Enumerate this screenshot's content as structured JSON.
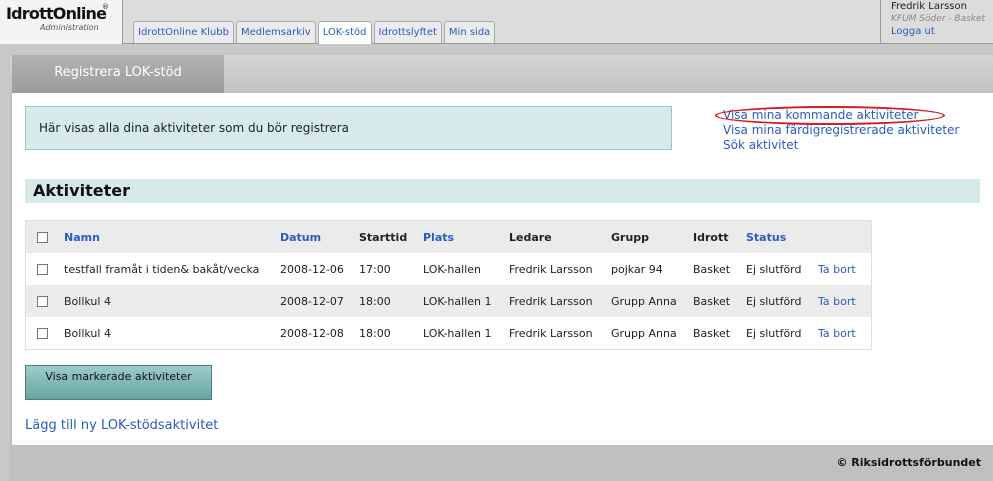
{
  "header": {
    "logo_text": "IdrottOnline",
    "logo_reg": "®",
    "logo_sub": "Administration",
    "tabs": [
      {
        "label": "IdrottOnline Klubb"
      },
      {
        "label": "Medlemsarkiv"
      },
      {
        "label": "LOK-stöd"
      },
      {
        "label": "Idrottslyftet"
      },
      {
        "label": "Min sida"
      }
    ],
    "active_tab": "LOK-stöd",
    "user": {
      "name": "Fredrik Larsson",
      "org": "KFUM Söder - Basket",
      "logout": "Logga ut"
    }
  },
  "page": {
    "tab_title": "Registrera LOK-stöd",
    "info_text": "Här visas alla dina aktiviteter som du bör registrera",
    "side_links": [
      {
        "label": "Visa mina kommande aktiviteter"
      },
      {
        "label": "Visa mina färdigregistrerade aktiviteter"
      },
      {
        "label": "Sök aktivitet"
      }
    ],
    "section_title": "Aktiviteter",
    "table": {
      "headers": {
        "name": "Namn",
        "date": "Datum",
        "start": "Starttid",
        "place": "Plats",
        "leader": "Ledare",
        "group": "Grupp",
        "sport": "Idrott",
        "status": "Status"
      },
      "rows": [
        {
          "name": "testfall framåt i tiden& bakåt/vecka",
          "date": "2008-12-06",
          "start": "17:00",
          "place": "LOK-hallen",
          "leader": "Fredrik Larsson",
          "group": "pojkar 94",
          "sport": "Basket",
          "status": "Ej slutförd",
          "action": "Ta bort"
        },
        {
          "name": "Bollkul 4",
          "date": "2008-12-07",
          "start": "18:00",
          "place": "LOK-hallen 1",
          "leader": "Fredrik Larsson",
          "group": "Grupp Anna",
          "sport": "Basket",
          "status": "Ej slutförd",
          "action": "Ta bort"
        },
        {
          "name": "Bollkul 4",
          "date": "2008-12-08",
          "start": "18:00",
          "place": "LOK-hallen 1",
          "leader": "Fredrik Larsson",
          "group": "Grupp Anna",
          "sport": "Basket",
          "status": "Ej slutförd",
          "action": "Ta bort"
        }
      ]
    },
    "show_button": "Visa markerade aktiviteter",
    "add_link": "Lägg till ny LOK-stödsaktivitet",
    "copyright": "© Riksidrottsförbundet"
  },
  "colors": {
    "link": "#2a5bbf",
    "info_bg": "#d6eaea",
    "button_bg": "#7fb5b5",
    "highlight": "#d41c1c"
  }
}
